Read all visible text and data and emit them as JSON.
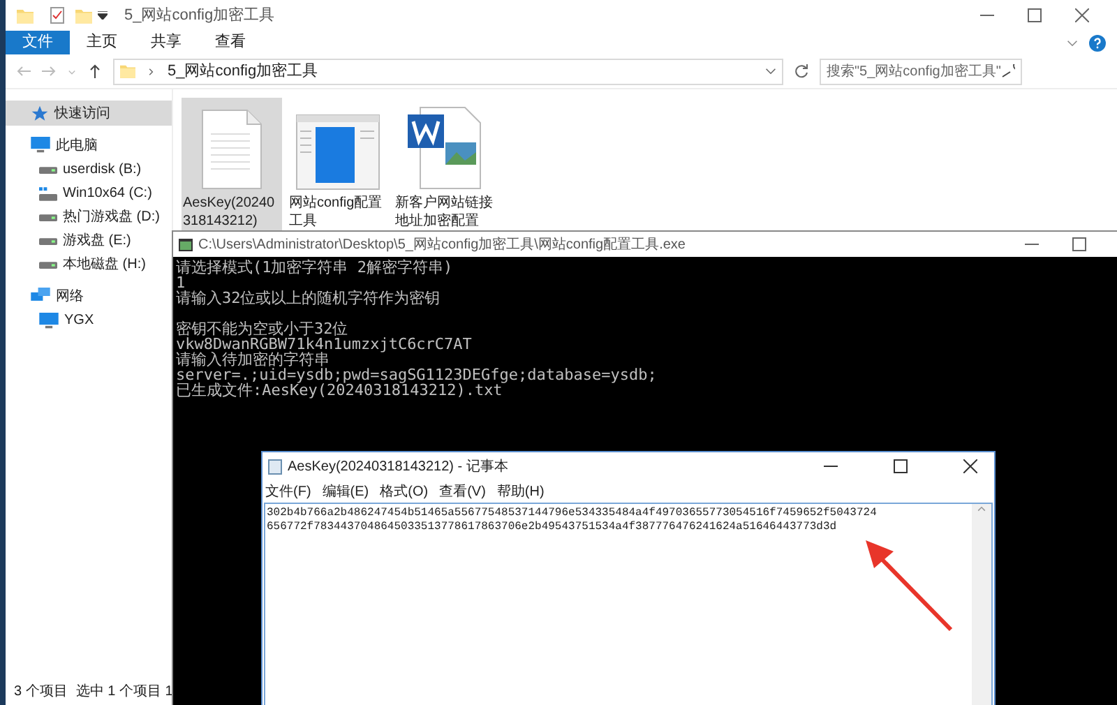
{
  "explorer": {
    "title": "5_网站config加密工具",
    "ribbon_tabs": [
      {
        "label": "文件",
        "selected": true
      },
      {
        "label": "主页",
        "selected": false
      },
      {
        "label": "共享",
        "selected": false
      },
      {
        "label": "查看",
        "selected": false
      }
    ],
    "address": "5_网站config加密工具",
    "search": {
      "placeholder": "搜索\"5_网站config加密工具\""
    },
    "nav": [
      {
        "label": "快速访问",
        "kind": "star",
        "selected": true
      },
      {
        "label": "此电脑",
        "kind": "pc",
        "selected": false,
        "children": [
          {
            "label": "userdisk (B:)",
            "kind": "drive",
            "selected": false
          },
          {
            "label": "Win10x64 (C:)",
            "kind": "windrive",
            "selected": false
          },
          {
            "label": "热门游戏盘 (D:)",
            "kind": "drive",
            "selected": false
          },
          {
            "label": "游戏盘 (E:)",
            "kind": "drive",
            "selected": false
          },
          {
            "label": "本地磁盘 (H:)",
            "kind": "drive",
            "selected": false
          }
        ]
      },
      {
        "label": "网络",
        "kind": "network",
        "selected": false,
        "children": [
          {
            "label": "YGX",
            "kind": "pc",
            "selected": false
          }
        ]
      }
    ],
    "files": [
      {
        "name": "AesKey(20240318143212)",
        "kind": "text",
        "selected": true
      },
      {
        "name": "网站config配置工具",
        "kind": "app",
        "selected": false
      },
      {
        "name": "新客户网站链接地址加密配置",
        "kind": "word",
        "selected": false
      }
    ],
    "status": [
      "3 个项目",
      "选中 1 个项目 1"
    ]
  },
  "console": {
    "title": "C:\\Users\\Administrator\\Desktop\\5_网站config加密工具\\网站config配置工具.exe",
    "blocks": [
      [
        "请选择模式(1加密字符串 2解密字符串)",
        "1",
        "请输入32位或以上的随机字符作为密钥"
      ],
      [
        "密钥不能为空或小于32位",
        "vkw8DwanRGBW71k4n1umzxjtC6crC7AT",
        "请输入待加密的字符串",
        "server=.;uid=ysdb;pwd=sagSG1123DEGfge;database=ysdb;",
        "已生成文件:AesKey(20240318143212).txt"
      ]
    ]
  },
  "notepad": {
    "title": "AesKey(20240318143212) - 记事本",
    "menu": [
      "文件(F)",
      "编辑(E)",
      "格式(O)",
      "查看(V)",
      "帮助(H)"
    ],
    "lines": [
      "302b4b766a2b486247454b51465a55677548537144796e534335484a4f49703655773054516f7459652f5043724",
      "656772f7834437048645033513778617863706e2b49543751534a4f387776476241624a51646443773d3d"
    ]
  }
}
